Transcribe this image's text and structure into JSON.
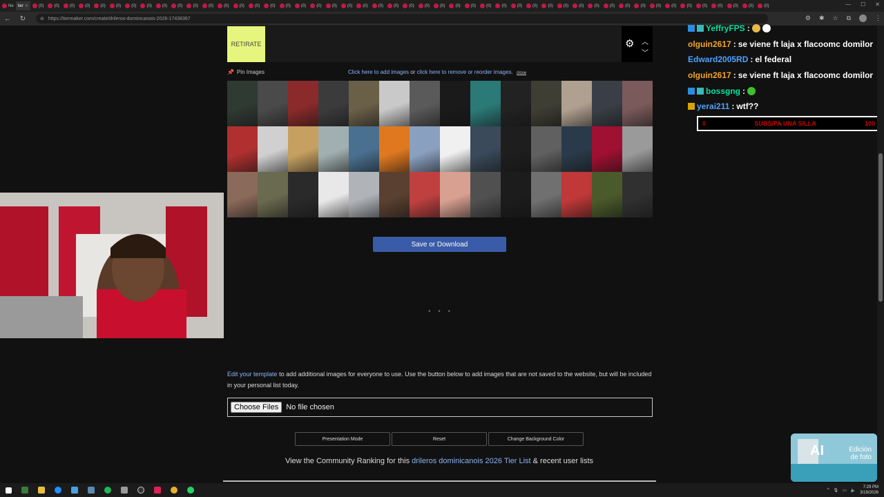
{
  "browser": {
    "url": "https://tiermaker.com/create/drileros-dominicanois-2026-17438367",
    "active_tab_label": "tier",
    "first_tab_label": "Ne",
    "tab_count_misc": "(0)"
  },
  "tier": {
    "label": "RETIRATE"
  },
  "pin_row": {
    "pin_label": "Pin Images",
    "add_link": "Click here to add images",
    "or_text": "or",
    "remove_link": "click here to remove or reorder images.",
    "close_label": "close"
  },
  "save_button": "Save or Download",
  "loading": "• • •",
  "edit": {
    "link": "Edit your template",
    "text": "to add additional images for everyone to use. Use the button below to add images that are not saved to the website, but will be included in your personal list today."
  },
  "file_input": {
    "button": "Choose Files",
    "status": "No file chosen"
  },
  "buttons": {
    "presentation": "Presentation Mode",
    "reset": "Reset",
    "change_bg": "Change Background Color"
  },
  "community": {
    "prefix": "View the Community Ranking for this",
    "link": "drileros dominicanois 2026 Tier List",
    "suffix": "& recent user lists"
  },
  "chat": [
    {
      "user": "YeffryFPS",
      "color": "#00e0a0",
      "message": "",
      "badges": [
        "blue",
        "teal"
      ],
      "emotes": [
        "#e5b94a",
        "#ffffff"
      ]
    },
    {
      "user": "olguin2617",
      "color": "#f5a623",
      "message": "se viene ft laja x flacoomc domilor",
      "badges": [],
      "emotes": []
    },
    {
      "user": "Edward2005RD",
      "color": "#4da3ff",
      "message": "el federal",
      "badges": [],
      "emotes": []
    },
    {
      "user": "olguin2617",
      "color": "#f5a623",
      "message": "se viene ft laja x flacoomc domilor",
      "badges": [],
      "emotes": []
    },
    {
      "user": "bossgng",
      "color": "#00e0a0",
      "message": "",
      "badges": [
        "blue",
        "teal"
      ],
      "emotes": [
        "#40c030"
      ]
    },
    {
      "user": "yerai211",
      "color": "#4da3ff",
      "message": "wtf??",
      "badges": [
        "crown"
      ],
      "emotes": []
    }
  ],
  "subs_bar": {
    "current": "0",
    "label": "SUBS/PA UNA SILLA",
    "goal": "100"
  },
  "widget": {
    "title": "AI",
    "line1": "Edición",
    "line2": "de foto"
  },
  "taskbar": {
    "time": "7:29 PM",
    "date": "3/19/2026"
  },
  "tile_colors": [
    "#2f3a33",
    "#4a4a4a",
    "#8a2a2a",
    "#3b3b3b",
    "#6a6048",
    "#c9c9c9",
    "#5a5a5a",
    "#1a1a1a",
    "#2b7a78",
    "#222222",
    "#3e3e34",
    "#b0a090",
    "#3a3f47",
    "#7a5a5a",
    "#b03030",
    "#d0d0d0",
    "#c6a060",
    "#a0b0b0",
    "#4a7090",
    "#e07820",
    "#8aa0c0",
    "#f0f0f0",
    "#3a4a5a",
    "#1e1e1e",
    "#606060",
    "#2a3a4a",
    "#a01030",
    "#9a9a9a",
    "#8a6a5a",
    "#6a6a50",
    "#2a2a2a",
    "#e8e8e8",
    "#b0b4b8",
    "#5a4030",
    "#c04040",
    "#d8a090",
    "#505050",
    "#1c1c1c",
    "#707070",
    "#c03838",
    "#4a5a2a",
    "#303030"
  ]
}
